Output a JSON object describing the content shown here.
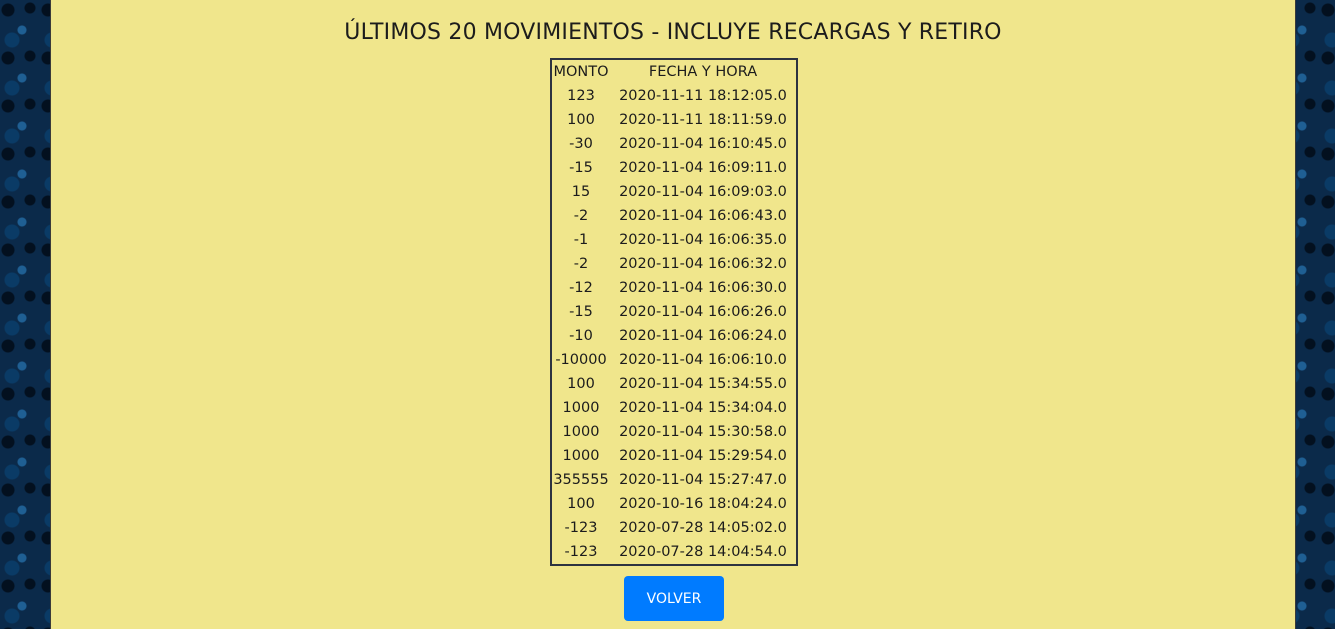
{
  "page": {
    "title": "ÚLTIMOS 20 MOVIMIENTOS - INCLUYE RECARGAS Y RETIRO",
    "back_button_label": "VOLVER"
  },
  "table": {
    "headers": [
      "MONTO",
      "FECHA Y HORA"
    ],
    "rows": [
      {
        "monto": "123",
        "fecha": "2020-11-11 18:12:05.0"
      },
      {
        "monto": "100",
        "fecha": "2020-11-11 18:11:59.0"
      },
      {
        "monto": "-30",
        "fecha": "2020-11-04 16:10:45.0"
      },
      {
        "monto": "-15",
        "fecha": "2020-11-04 16:09:11.0"
      },
      {
        "monto": "15",
        "fecha": "2020-11-04 16:09:03.0"
      },
      {
        "monto": "-2",
        "fecha": "2020-11-04 16:06:43.0"
      },
      {
        "monto": "-1",
        "fecha": "2020-11-04 16:06:35.0"
      },
      {
        "monto": "-2",
        "fecha": "2020-11-04 16:06:32.0"
      },
      {
        "monto": "-12",
        "fecha": "2020-11-04 16:06:30.0"
      },
      {
        "monto": "-15",
        "fecha": "2020-11-04 16:06:26.0"
      },
      {
        "monto": "-10",
        "fecha": "2020-11-04 16:06:24.0"
      },
      {
        "monto": "-10000",
        "fecha": "2020-11-04 16:06:10.0"
      },
      {
        "monto": "100",
        "fecha": "2020-11-04 15:34:55.0"
      },
      {
        "monto": "1000",
        "fecha": "2020-11-04 15:34:04.0"
      },
      {
        "monto": "1000",
        "fecha": "2020-11-04 15:30:58.0"
      },
      {
        "monto": "1000",
        "fecha": "2020-11-04 15:29:54.0"
      },
      {
        "monto": "355555",
        "fecha": "2020-11-04 15:27:47.0"
      },
      {
        "monto": "100",
        "fecha": "2020-10-16 18:04:24.0"
      },
      {
        "monto": "-123",
        "fecha": "2020-07-28 14:05:02.0"
      },
      {
        "monto": "-123",
        "fecha": "2020-07-28 14:04:54.0"
      }
    ]
  },
  "colors": {
    "panel_background": "#f0e68c",
    "button_background": "#007bff",
    "page_background": "#0b2a4a"
  }
}
